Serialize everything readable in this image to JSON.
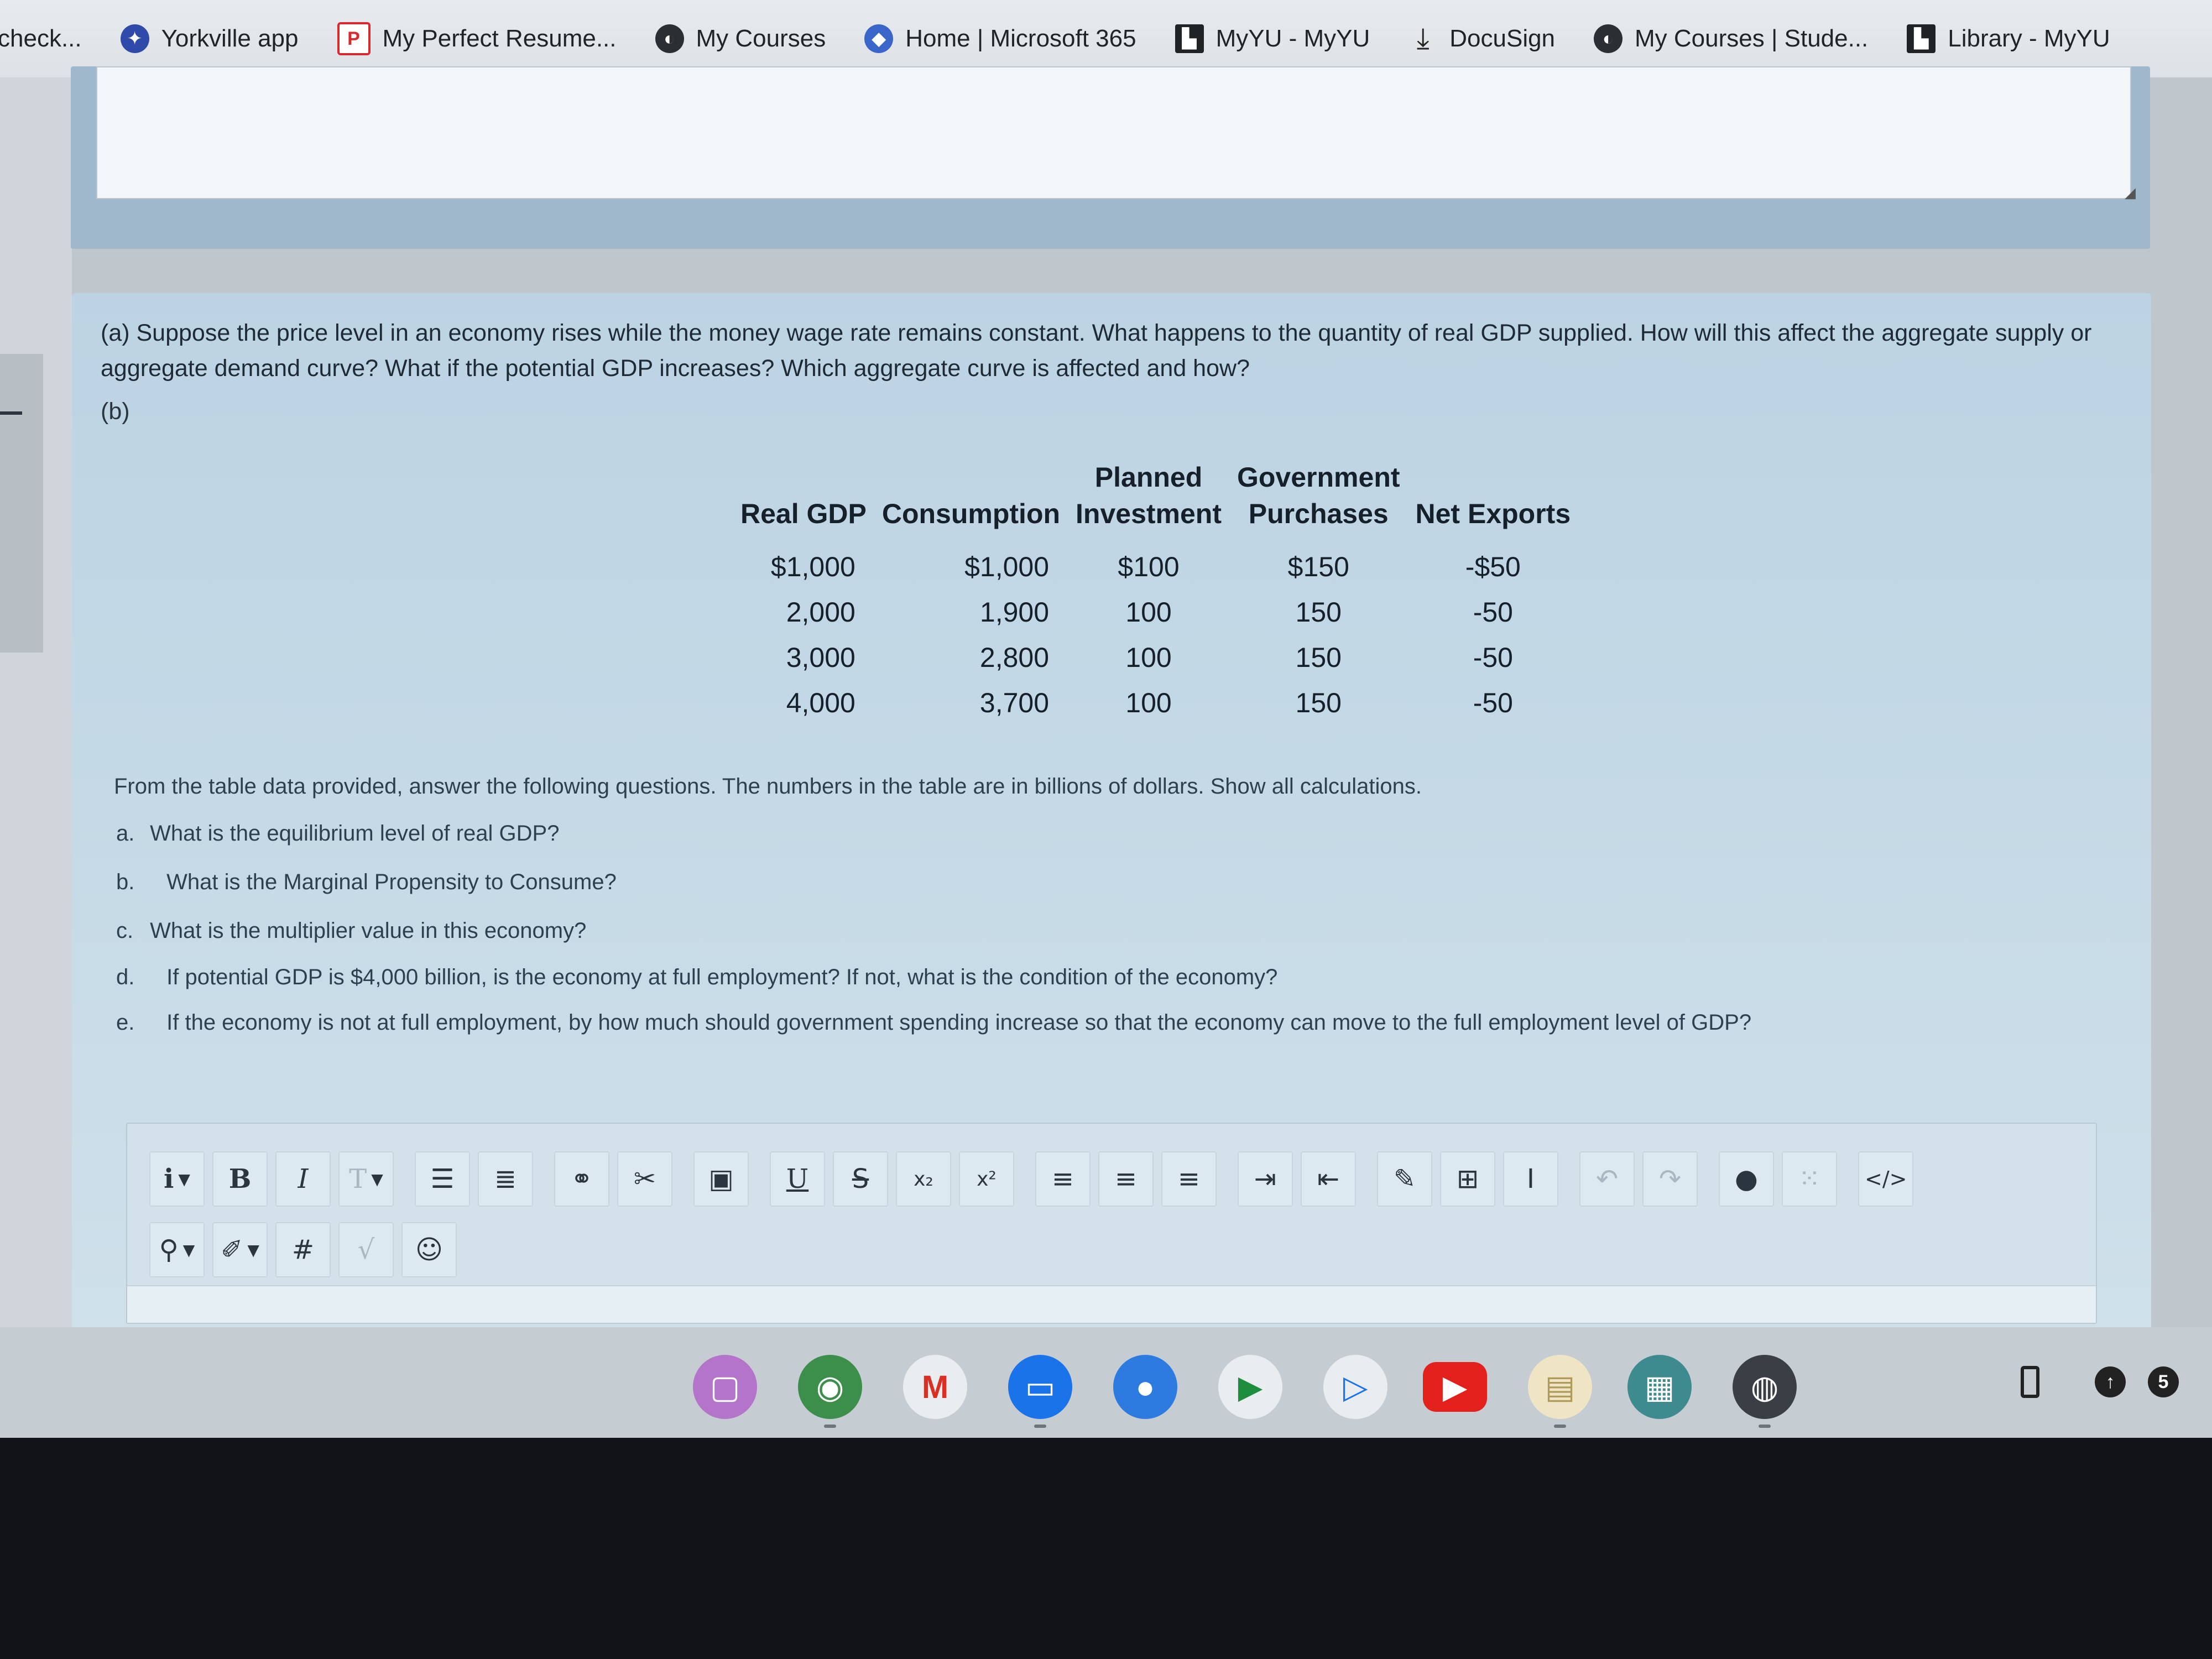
{
  "bookmarks": [
    {
      "label": "check...",
      "icon": "none"
    },
    {
      "label": "Yorkville app",
      "icon": "yorkville-icon"
    },
    {
      "label": "My Perfect Resume...",
      "icon": "resume-icon"
    },
    {
      "label": "My Courses",
      "icon": "globe-icon"
    },
    {
      "label": "Home | Microsoft 365",
      "icon": "microsoft-icon"
    },
    {
      "label": "MyYU - MyYU",
      "icon": "myyu-icon"
    },
    {
      "label": "DocuSign",
      "icon": "docusign-icon"
    },
    {
      "label": "My Courses | Stude...",
      "icon": "globe-icon"
    },
    {
      "label": "Library - MyYU",
      "icon": "myyu-icon"
    }
  ],
  "question": {
    "part_a": "(a) Suppose the price level in an economy rises while the money wage rate remains constant. What happens to the quantity of real GDP supplied. How will this affect the aggregate supply or aggregate demand curve? What if the potential GDP increases? Which aggregate curve is affected and how?",
    "part_b": "(b)",
    "table": {
      "headers": [
        "Real GDP",
        "Consumption",
        "Planned Investment",
        "Government Purchases",
        "Net Exports"
      ],
      "rows": [
        [
          "$1,000",
          "$1,000",
          "$100",
          "$150",
          "-$50"
        ],
        [
          "2,000",
          "1,900",
          "100",
          "150",
          "-50"
        ],
        [
          "3,000",
          "2,800",
          "100",
          "150",
          "-50"
        ],
        [
          "4,000",
          "3,700",
          "100",
          "150",
          "-50"
        ]
      ]
    },
    "instructions": "From the table data provided, answer the following questions. The numbers in the table are in billions of dollars. Show all calculations.",
    "subquestions": [
      {
        "label": "a.",
        "text": "What is the equilibrium level of real GDP?"
      },
      {
        "label": "b.",
        "text": "What is the Marginal Propensity to Consume?"
      },
      {
        "label": "c.",
        "text": "What is the multiplier value in this economy?"
      },
      {
        "label": "d.",
        "text": "If potential GDP is $4,000 billion, is the economy at full employment? If not, what is the condition of the economy?"
      },
      {
        "label": "e.",
        "text": "If the economy is not at full employment, by how much should government spending increase so that the economy can move to the full employment level of GDP?"
      }
    ]
  },
  "toolbar": {
    "row1": [
      "i",
      "B",
      "I",
      "T",
      "bulleted-list-icon",
      "numbered-list-icon",
      "link-icon",
      "unlink-icon",
      "image-icon",
      "U",
      "S",
      "x₂",
      "x²",
      "align-left-icon",
      "align-center-icon",
      "align-right-icon",
      "indent-icon",
      "outdent-icon",
      "edit-icon",
      "table-icon",
      "text-cursor-icon",
      "undo-icon",
      "redo-icon",
      "info-icon",
      "special-chars-icon",
      "code-icon"
    ],
    "row2": [
      "marker-icon",
      "brush-icon",
      "#",
      "√",
      "☺"
    ]
  },
  "shelf": {
    "apps": [
      "notes-icon",
      "chrome-icon",
      "gmail-icon",
      "files-icon",
      "chat-icon",
      "meet-icon",
      "play-store-icon",
      "youtube-icon",
      "keep-icon",
      "calculator-icon",
      "avatar-icon"
    ],
    "tray": {
      "notification_count": "5"
    }
  },
  "colors": {
    "panel": "#c2d8e6",
    "prev_box": "#9fb8cc",
    "bezel": "#111316"
  }
}
